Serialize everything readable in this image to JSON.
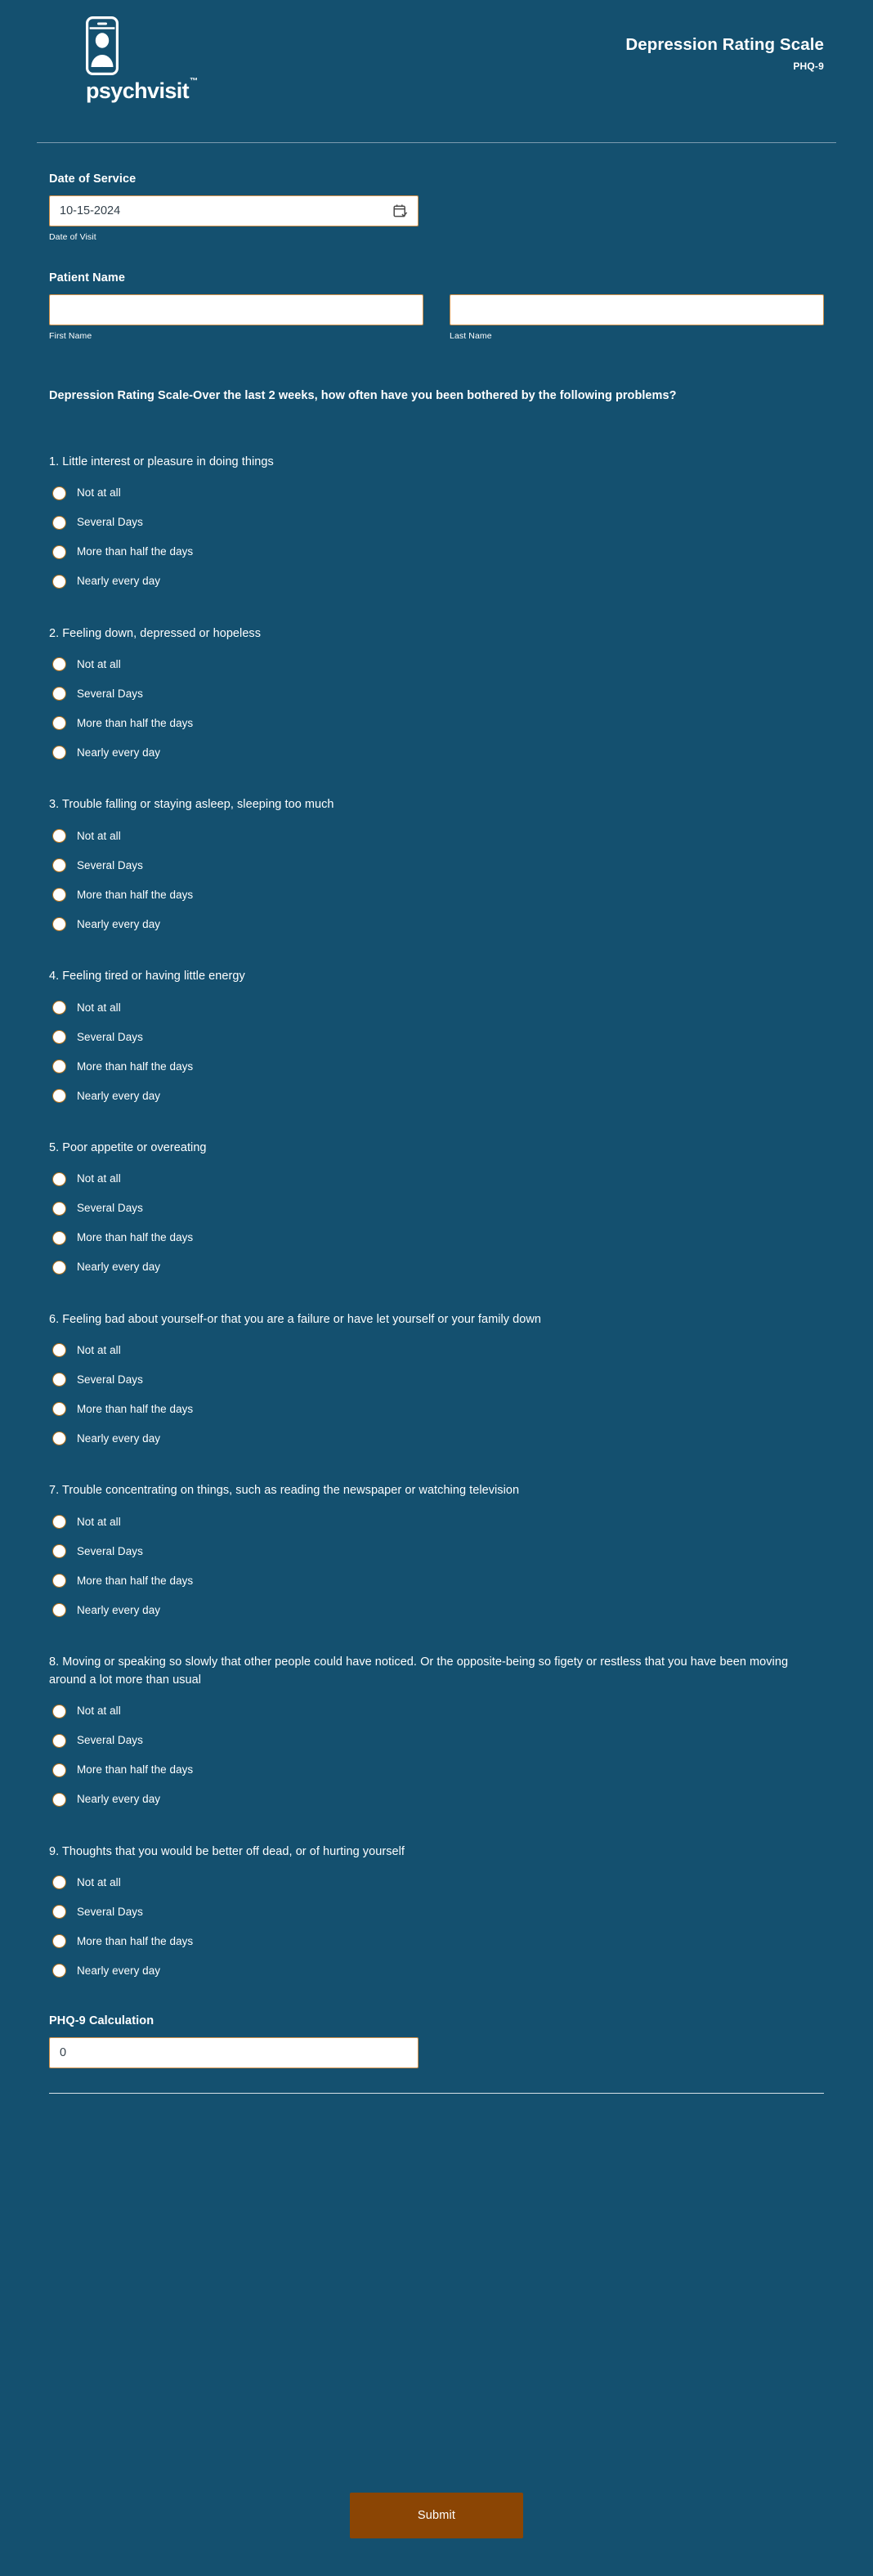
{
  "header": {
    "brand_name": "psychvisit",
    "brand_tm": "™",
    "logo_icon": "phone-person-icon",
    "doc_title": "Depression Rating Scale",
    "doc_subtitle": "PHQ-9"
  },
  "date_of_service": {
    "label": "Date of Service",
    "value": "10-15-2024",
    "placeholder": "",
    "sub_label": "Date of Visit",
    "icon": "calendar-check-icon"
  },
  "patient_name": {
    "label": "Patient Name",
    "first": {
      "value": "",
      "placeholder": "",
      "sub_label": "First Name"
    },
    "last": {
      "value": "",
      "placeholder": "",
      "sub_label": "Last Name"
    }
  },
  "intro": "Depression Rating Scale-Over the last 2 weeks, how often have you been bothered by the following problems?",
  "options": [
    "Not at all",
    "Several Days",
    "More than half the days",
    "Nearly every day"
  ],
  "questions": [
    {
      "number": "1.",
      "text": "1. Little interest or pleasure in doing things"
    },
    {
      "number": "2.",
      "text": "2. Feeling down, depressed or hopeless"
    },
    {
      "number": "3.",
      "text": "3. Trouble falling or staying asleep, sleeping too much"
    },
    {
      "number": "4.",
      "text": "4. Feeling tired or having little energy"
    },
    {
      "number": "5.",
      "text": "5. Poor appetite or overeating"
    },
    {
      "number": "6.",
      "text": "6. Feeling bad about yourself-or that you are a failure or have let yourself or your family down"
    },
    {
      "number": "7.",
      "text": "7. Trouble concentrating on things, such as reading the newspaper or watching television"
    },
    {
      "number": "8.",
      "text": "8. Moving or speaking so slowly that other people could have noticed. Or the opposite-being so figety or restless that you have been moving around a lot more than usual"
    },
    {
      "number": "9.",
      "text": "9. Thoughts that you would be better off dead, or of hurting yourself"
    }
  ],
  "calculation": {
    "label": "PHQ-9 Calculation",
    "value": "0",
    "placeholder": ""
  },
  "footer": {
    "submit_label": "Submit"
  },
  "colors": {
    "background": "#14506f",
    "input_border": "#cf8f48",
    "radio_border": "#b5741f",
    "submit_bg": "#8b4504",
    "text": "#ffffff"
  }
}
